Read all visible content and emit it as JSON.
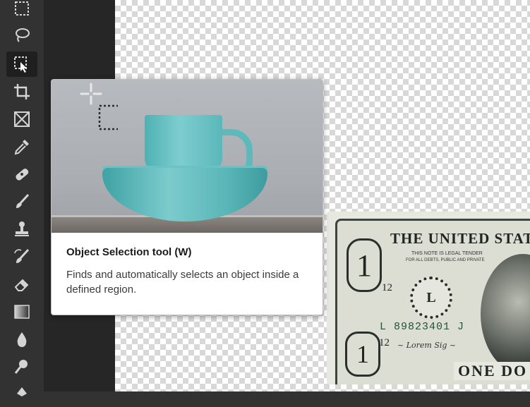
{
  "toolbar": {
    "tools": [
      {
        "name": "rectangular-marquee-icon",
        "active": false
      },
      {
        "name": "lasso-icon",
        "active": false
      },
      {
        "name": "object-selection-icon",
        "active": true
      },
      {
        "name": "crop-icon",
        "active": false
      },
      {
        "name": "frame-icon",
        "active": false
      },
      {
        "name": "eyedropper-icon",
        "active": false
      },
      {
        "name": "healing-brush-icon",
        "active": false
      },
      {
        "name": "brush-icon",
        "active": false
      },
      {
        "name": "clone-stamp-icon",
        "active": false
      },
      {
        "name": "history-brush-icon",
        "active": false
      },
      {
        "name": "eraser-icon",
        "active": false
      },
      {
        "name": "gradient-icon",
        "active": false
      },
      {
        "name": "blur-icon",
        "active": false
      },
      {
        "name": "dodge-icon",
        "active": false
      }
    ]
  },
  "tooltip": {
    "title": "Object Selection tool (W)",
    "description": "Finds and automatically selects an object inside a defined region."
  },
  "bill": {
    "banner": "THE UNITED STATES",
    "legal_line1": "THIS NOTE IS LEGAL TENDER",
    "legal_line2": "FOR ALL DEBTS, PUBLIC AND PRIVATE",
    "serial": "L 89823401 J",
    "district_number": "12",
    "seal_letter": "L",
    "corner_denomination": "1",
    "denomination_word": "ONE DO"
  },
  "colors": {
    "toolbar_bg": "#323232",
    "active_tool_bg": "#1f1f1f",
    "icon": "#d4d4d4",
    "cup": "#6cc6c8"
  }
}
